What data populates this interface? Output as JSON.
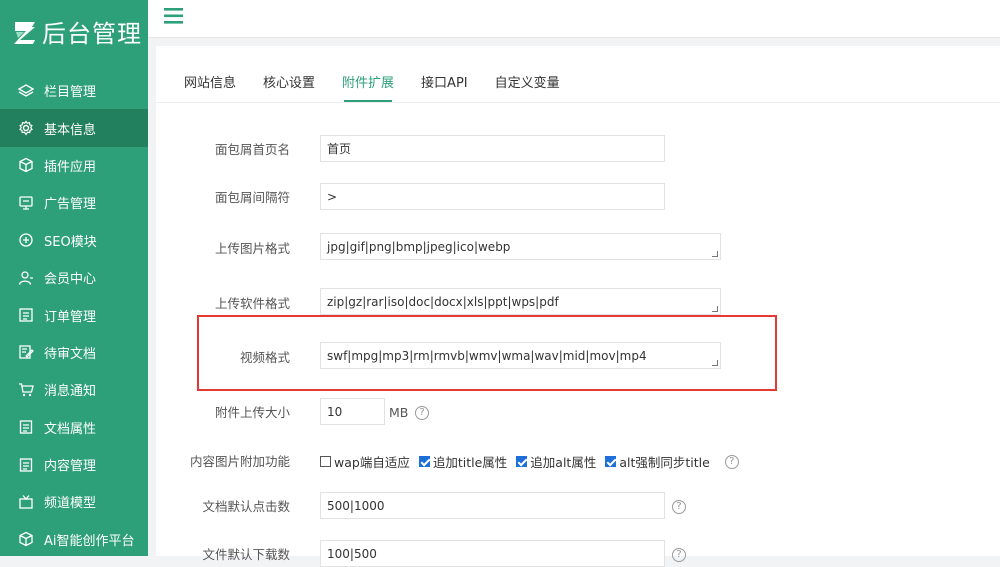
{
  "app": {
    "logo_text": "后台管理"
  },
  "sidebar": {
    "items": [
      {
        "label": "栏目管理",
        "icon": "layers-icon"
      },
      {
        "label": "基本信息",
        "icon": "settings-gear-icon",
        "active": true
      },
      {
        "label": "插件应用",
        "icon": "cube-icon"
      },
      {
        "label": "广告管理",
        "icon": "flag-icon"
      },
      {
        "label": "SEO模块",
        "icon": "target-icon"
      },
      {
        "label": "会员中心",
        "icon": "user-icon"
      },
      {
        "label": "订单管理",
        "icon": "list-icon"
      },
      {
        "label": "待审文档",
        "icon": "edit-doc-icon"
      },
      {
        "label": "消息通知",
        "icon": "cart-icon"
      },
      {
        "label": "文档属性",
        "icon": "doc-icon"
      },
      {
        "label": "内容管理",
        "icon": "doc-icon"
      },
      {
        "label": "频道模型",
        "icon": "tv-icon"
      },
      {
        "label": "Ai智能创作平台",
        "icon": "cube-icon"
      }
    ]
  },
  "tabs": [
    {
      "label": "网站信息"
    },
    {
      "label": "核心设置"
    },
    {
      "label": "附件扩展",
      "active": true
    },
    {
      "label": "接口API"
    },
    {
      "label": "自定义变量"
    }
  ],
  "form": {
    "breadcrumb_home": {
      "label": "面包屑首页名",
      "value": "首页"
    },
    "breadcrumb_sep": {
      "label": "面包屑间隔符",
      "value": ">"
    },
    "image_formats": {
      "label": "上传图片格式",
      "value": "jpg|gif|png|bmp|jpeg|ico|webp"
    },
    "software_formats": {
      "label": "上传软件格式",
      "value": "zip|gz|rar|iso|doc|docx|xls|ppt|wps|pdf"
    },
    "video_formats": {
      "label": "视频格式",
      "value": "swf|mpg|mp3|rm|rmvb|wmv|wma|wav|mid|mov|mp4"
    },
    "attach_size": {
      "label": "附件上传大小",
      "value": "10",
      "unit": "MB",
      "help": "?"
    },
    "image_features": {
      "label": "内容图片附加功能",
      "options": [
        {
          "label": "wap端自适应",
          "checked": false
        },
        {
          "label": "追加title属性",
          "checked": true
        },
        {
          "label": "追加alt属性",
          "checked": true
        },
        {
          "label": "alt强制同步title",
          "checked": true
        }
      ],
      "help": "?"
    },
    "default_clicks": {
      "label": "文档默认点击数",
      "value": "500|1000",
      "help": "?"
    },
    "default_downloads": {
      "label": "文件默认下载数",
      "value": "100|500",
      "help": "?"
    }
  },
  "colors": {
    "brand": "#2ea079",
    "sidebar_active": "#23805f",
    "highlight": "#e53935"
  }
}
